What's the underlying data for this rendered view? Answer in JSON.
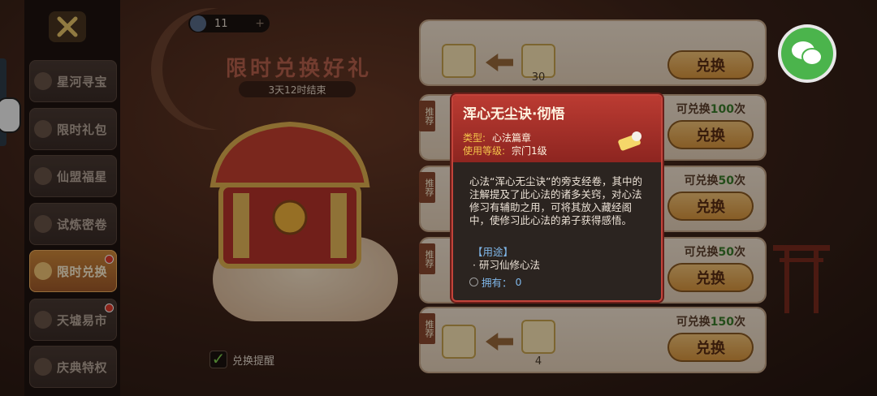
{
  "currency": {
    "value": "11",
    "plus": "+"
  },
  "event": {
    "title": "限时兑换好礼",
    "timer": "3天12时结束"
  },
  "sidebar": {
    "items": [
      {
        "label": "星河寻宝",
        "active": false,
        "badge": false
      },
      {
        "label": "限时礼包",
        "active": false,
        "badge": false
      },
      {
        "label": "仙盟福星",
        "active": false,
        "badge": false
      },
      {
        "label": "试炼密卷",
        "active": false,
        "badge": false
      },
      {
        "label": "限时兑换",
        "active": true,
        "badge": true
      },
      {
        "label": "天墟易市",
        "active": false,
        "badge": true
      },
      {
        "label": "庆典特权",
        "active": false,
        "badge": false
      }
    ]
  },
  "remind": {
    "label": "兑换提醒",
    "checked": true
  },
  "rows": [
    {
      "tag": "",
      "limit_prefix": "",
      "limit_num": "",
      "limit_suffix": "",
      "count": "30",
      "button": "兑换"
    },
    {
      "tag": "推荐",
      "limit_prefix": "可兑换",
      "limit_num": "100",
      "limit_suffix": "次",
      "count": "",
      "button": "兑换"
    },
    {
      "tag": "推荐",
      "limit_prefix": "可兑换",
      "limit_num": "50",
      "limit_suffix": "次",
      "count": "",
      "button": "兑换"
    },
    {
      "tag": "推荐",
      "limit_prefix": "可兑换",
      "limit_num": "50",
      "limit_suffix": "次",
      "count": "",
      "button": "兑换"
    },
    {
      "tag": "推荐",
      "limit_prefix": "可兑换",
      "limit_num": "150",
      "limit_suffix": "次",
      "count": "4",
      "button": "兑换"
    }
  ],
  "tooltip": {
    "name": "浑心无尘诀·彻悟",
    "type_label": "类型:",
    "type_value": "心法篇章",
    "level_label": "使用等级:",
    "level_value": "宗门1级",
    "description": "心法“浑心无尘诀”的旁支经卷，其中的注解提及了此心法的诸多关窍，对心法修习有辅助之用，可将其放入藏经阁中，使修习此心法的弟子获得感悟。",
    "usage_heading": "【用途】",
    "usage_item": "· 研习仙修心法",
    "own_label": "拥有：",
    "own_value": "0"
  },
  "colors": {
    "accent_red": "#bb3b32",
    "gold": "#f3c34a",
    "button": "#e0a24a",
    "wechat": "#4bb44c"
  },
  "icons": [
    "close-x-icon",
    "currency-orb-icon",
    "wechat-icon",
    "scroll-item-icon",
    "checkmark-icon",
    "arrow-left-icon"
  ]
}
